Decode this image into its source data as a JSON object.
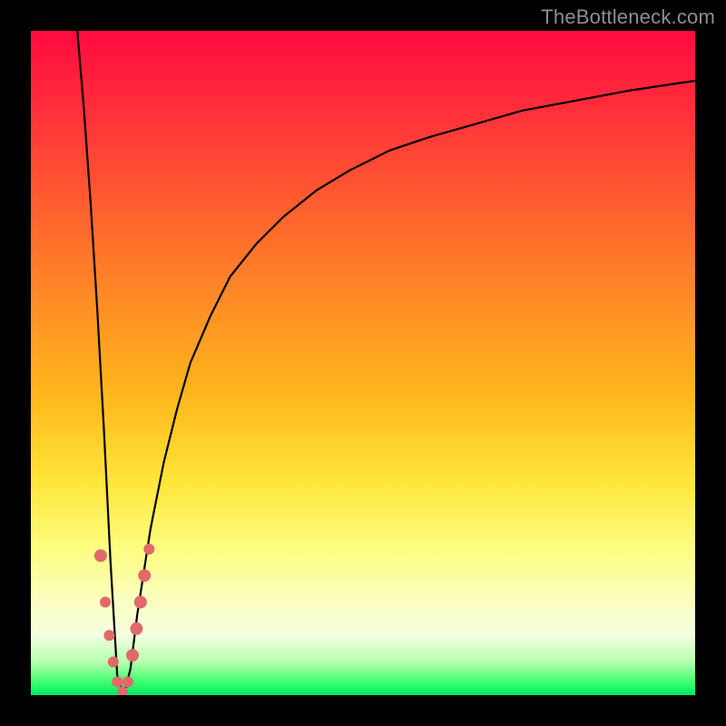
{
  "attribution": "TheBottleneck.com",
  "chart_data": {
    "type": "line",
    "title": "",
    "xlabel": "",
    "ylabel": "",
    "xlim": [
      0,
      100
    ],
    "ylim": [
      0,
      100
    ],
    "grid": false,
    "legend": false,
    "series": [
      {
        "name": "bottleneck-curve",
        "x": [
          7,
          8,
          9,
          10,
          11,
          12,
          13,
          14,
          15,
          16,
          18,
          20,
          22,
          24,
          27,
          30,
          34,
          38,
          43,
          48,
          54,
          60,
          67,
          74,
          82,
          90,
          100
        ],
        "values": [
          100,
          88,
          74,
          58,
          40,
          20,
          3,
          0,
          4,
          12,
          25,
          35,
          43,
          50,
          57,
          63,
          68,
          72,
          76,
          79,
          82,
          84,
          86,
          88,
          89.5,
          91,
          92.5
        ]
      }
    ],
    "markers": [
      {
        "x": 10.5,
        "y": 21,
        "r": 7
      },
      {
        "x": 11.2,
        "y": 14,
        "r": 6
      },
      {
        "x": 11.8,
        "y": 9,
        "r": 6
      },
      {
        "x": 12.4,
        "y": 5,
        "r": 6
      },
      {
        "x": 13.0,
        "y": 2,
        "r": 6
      },
      {
        "x": 13.8,
        "y": 0.5,
        "r": 6
      },
      {
        "x": 14.6,
        "y": 2,
        "r": 6
      },
      {
        "x": 15.3,
        "y": 6,
        "r": 7
      },
      {
        "x": 15.9,
        "y": 10,
        "r": 7
      },
      {
        "x": 16.5,
        "y": 14,
        "r": 7
      },
      {
        "x": 17.1,
        "y": 18,
        "r": 7
      },
      {
        "x": 17.8,
        "y": 22,
        "r": 6
      }
    ],
    "marker_color": "#e06a6a",
    "curve_color": "#000000",
    "gradient_stops": [
      {
        "pos": 0,
        "color": "#ff0a40"
      },
      {
        "pos": 12,
        "color": "#ff2f3a"
      },
      {
        "pos": 25,
        "color": "#ff5a30"
      },
      {
        "pos": 40,
        "color": "#ff8a26"
      },
      {
        "pos": 55,
        "color": "#ffb71c"
      },
      {
        "pos": 68,
        "color": "#ffe63a"
      },
      {
        "pos": 78,
        "color": "#fdfd80"
      },
      {
        "pos": 86,
        "color": "#fbfec2"
      },
      {
        "pos": 91,
        "color": "#f3ffe0"
      },
      {
        "pos": 95,
        "color": "#b7ffb0"
      },
      {
        "pos": 98,
        "color": "#3fff70"
      },
      {
        "pos": 100,
        "color": "#00e865"
      }
    ]
  }
}
